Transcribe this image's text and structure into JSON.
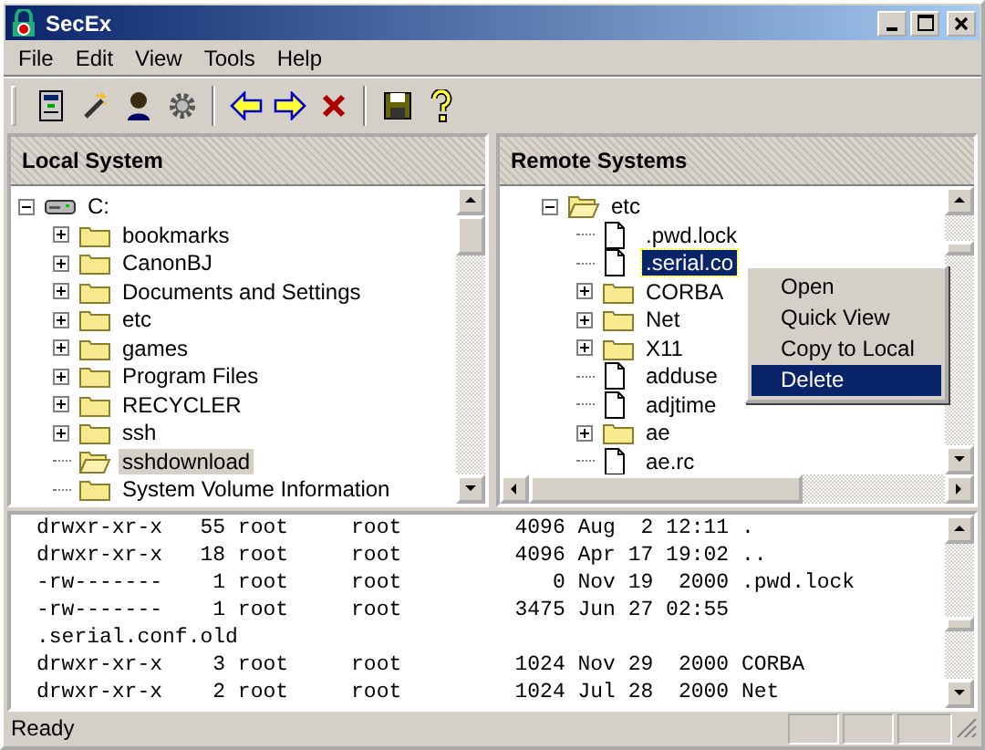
{
  "window": {
    "title": "SecEx"
  },
  "menu_bar": [
    "File",
    "Edit",
    "View",
    "Tools",
    "Help"
  ],
  "local_pane": {
    "title": "Local System",
    "tree": [
      {
        "label": "C:",
        "kind": "drive",
        "expandable": true,
        "expanded": true,
        "selected": false,
        "children": [
          {
            "label": "bookmarks",
            "kind": "folder",
            "expandable": true,
            "expanded": false,
            "selected": false
          },
          {
            "label": "CanonBJ",
            "kind": "folder",
            "expandable": true,
            "expanded": false,
            "selected": false
          },
          {
            "label": "Documents and Settings",
            "kind": "folder",
            "expandable": true,
            "expanded": false,
            "selected": false
          },
          {
            "label": "etc",
            "kind": "folder",
            "expandable": true,
            "expanded": false,
            "selected": false
          },
          {
            "label": "games",
            "kind": "folder",
            "expandable": true,
            "expanded": false,
            "selected": false
          },
          {
            "label": "Program Files",
            "kind": "folder",
            "expandable": true,
            "expanded": false,
            "selected": false
          },
          {
            "label": "RECYCLER",
            "kind": "folder",
            "expandable": true,
            "expanded": false,
            "selected": false
          },
          {
            "label": "ssh",
            "kind": "folder",
            "expandable": true,
            "expanded": false,
            "selected": false
          },
          {
            "label": "sshdownload",
            "kind": "folder",
            "expandable": false,
            "expanded": true,
            "selected": true
          },
          {
            "label": "System Volume Information",
            "kind": "folder",
            "expandable": false,
            "expanded": false,
            "selected": false
          }
        ]
      }
    ]
  },
  "remote_pane": {
    "title": "Remote Systems",
    "tree": [
      {
        "label": "etc",
        "kind": "folder",
        "expandable": true,
        "expanded": true,
        "selected": false,
        "children": [
          {
            "label": ".pwd.lock",
            "kind": "file",
            "expandable": false,
            "selected": false
          },
          {
            "label": ".serial.co",
            "kind": "file",
            "expandable": false,
            "selected": true
          },
          {
            "label": "CORBA",
            "kind": "folder",
            "expandable": true,
            "expanded": false,
            "selected": false
          },
          {
            "label": "Net",
            "kind": "folder",
            "expandable": true,
            "expanded": false,
            "selected": false
          },
          {
            "label": "X11",
            "kind": "folder",
            "expandable": true,
            "expanded": false,
            "selected": false
          },
          {
            "label": "adduse",
            "kind": "file",
            "expandable": false,
            "selected": false
          },
          {
            "label": "adjtime",
            "kind": "file",
            "expandable": false,
            "selected": false
          },
          {
            "label": "ae",
            "kind": "folder",
            "expandable": true,
            "expanded": false,
            "selected": false
          },
          {
            "label": "ae.rc",
            "kind": "file",
            "expandable": false,
            "selected": false
          }
        ]
      }
    ],
    "context_menu": [
      {
        "label": "Open",
        "selected": false
      },
      {
        "label": "Quick View",
        "selected": false
      },
      {
        "label": "Copy to Local",
        "selected": false
      },
      {
        "label": "Delete",
        "selected": true
      }
    ]
  },
  "log": [
    "drwxr-xr-x   55 root     root         4096 Aug  2 12:11 .",
    "drwxr-xr-x   18 root     root         4096 Apr 17 19:02 ..",
    "-rw-------    1 root     root            0 Nov 19  2000 .pwd.lock",
    "-rw-------    1 root     root         3475 Jun 27 02:55",
    ".serial.conf.old",
    "drwxr-xr-x    3 root     root         1024 Nov 29  2000 CORBA",
    "drwxr-xr-x    2 root     root         1024 Jul 28  2000 Net"
  ],
  "status_bar": {
    "text": "Ready"
  }
}
